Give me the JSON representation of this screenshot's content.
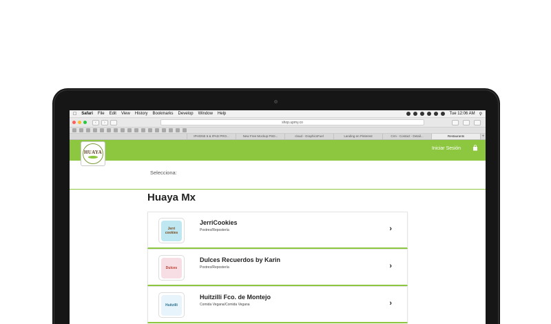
{
  "menubar": {
    "apple": "",
    "items": [
      "Safari",
      "File",
      "Edit",
      "View",
      "History",
      "Bookmarks",
      "Develop",
      "Window",
      "Help"
    ],
    "clock": "Tue 12:06 AM"
  },
  "toolbar": {
    "address": "shop.upmy.co"
  },
  "tabs": [
    "IPHONE 6 & IPAD PRO...",
    "New Free Mockup PSD...",
    "cloud - GraphicsFuel",
    "Landing en Pinterest",
    "Crm - Contact - Detail...",
    "Restaurants"
  ],
  "header": {
    "logo_text": "HUAYA",
    "login_label": "Iniciar Sesión",
    "brand_color": "#8dc63f"
  },
  "content": {
    "select_label": "Selecciona:",
    "section_title": "Huaya Mx",
    "stores": [
      {
        "name": "JerriCookies",
        "category": "Postres/Repostería",
        "thumb_text": "Jerri cookies",
        "thumb_color": "#bfe7f2",
        "thumb_text_color": "#7a4a1e"
      },
      {
        "name": "Dulces Recuerdos by Karin",
        "category": "Postres/Repostería",
        "thumb_text": "Dulces",
        "thumb_color": "#f7dde4",
        "thumb_text_color": "#c0392b"
      },
      {
        "name": "Huitzilli Fco. de Montejo",
        "category": "Comida Vegana/Comida Vegana",
        "thumb_text": "Huitzilli",
        "thumb_color": "#e8f4fb",
        "thumb_text_color": "#2a6f8f"
      }
    ],
    "chevron": "›"
  }
}
